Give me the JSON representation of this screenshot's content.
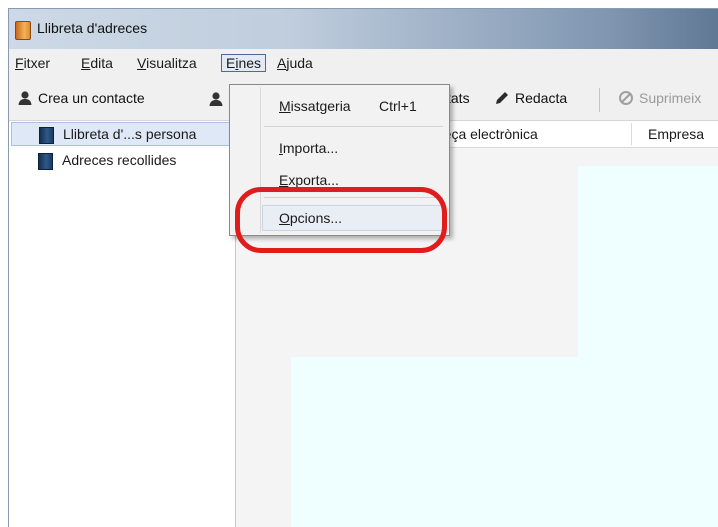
{
  "window": {
    "title": "Llibreta d'adreces"
  },
  "menubar": {
    "items": [
      {
        "label": "Fitxer"
      },
      {
        "label": "Edita"
      },
      {
        "label": "Visualitza"
      },
      {
        "label": "Eines"
      },
      {
        "label": "Ajuda"
      }
    ]
  },
  "toolbar": {
    "new_contact_label": "Crea un contacte",
    "properties_label": "tats",
    "compose_label": "Redacta",
    "delete_label": "Suprimeix"
  },
  "sidebar": {
    "items": [
      {
        "label": "Llibreta d'...s persona"
      },
      {
        "label": "Adreces recollides"
      }
    ]
  },
  "table": {
    "columns": [
      {
        "label": "reça electrònica"
      },
      {
        "label": "Empresa"
      }
    ]
  },
  "tools_menu": {
    "items": [
      {
        "label": "Missatgeria",
        "shortcut": "Ctrl+1"
      },
      {
        "label": "Importa..."
      },
      {
        "label": "Exporta..."
      },
      {
        "label": "Opcions..."
      }
    ]
  },
  "colors": {
    "highlight_circle": "#e01c1c",
    "selection": "#dfe8f6"
  }
}
